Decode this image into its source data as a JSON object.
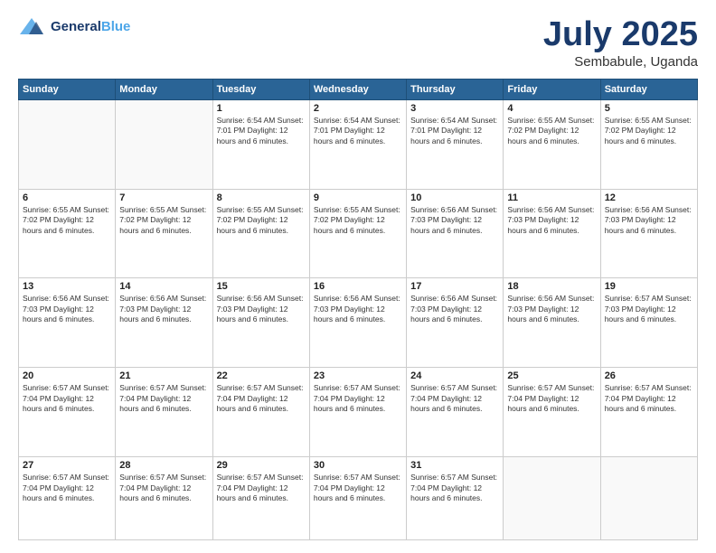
{
  "header": {
    "logo_line1": "General",
    "logo_line2": "Blue",
    "month": "July 2025",
    "location": "Sembabule, Uganda"
  },
  "days_of_week": [
    "Sunday",
    "Monday",
    "Tuesday",
    "Wednesday",
    "Thursday",
    "Friday",
    "Saturday"
  ],
  "weeks": [
    [
      {
        "day": "",
        "info": ""
      },
      {
        "day": "",
        "info": ""
      },
      {
        "day": "1",
        "info": "Sunrise: 6:54 AM\nSunset: 7:01 PM\nDaylight: 12 hours\nand 6 minutes."
      },
      {
        "day": "2",
        "info": "Sunrise: 6:54 AM\nSunset: 7:01 PM\nDaylight: 12 hours\nand 6 minutes."
      },
      {
        "day": "3",
        "info": "Sunrise: 6:54 AM\nSunset: 7:01 PM\nDaylight: 12 hours\nand 6 minutes."
      },
      {
        "day": "4",
        "info": "Sunrise: 6:55 AM\nSunset: 7:02 PM\nDaylight: 12 hours\nand 6 minutes."
      },
      {
        "day": "5",
        "info": "Sunrise: 6:55 AM\nSunset: 7:02 PM\nDaylight: 12 hours\nand 6 minutes."
      }
    ],
    [
      {
        "day": "6",
        "info": "Sunrise: 6:55 AM\nSunset: 7:02 PM\nDaylight: 12 hours\nand 6 minutes."
      },
      {
        "day": "7",
        "info": "Sunrise: 6:55 AM\nSunset: 7:02 PM\nDaylight: 12 hours\nand 6 minutes."
      },
      {
        "day": "8",
        "info": "Sunrise: 6:55 AM\nSunset: 7:02 PM\nDaylight: 12 hours\nand 6 minutes."
      },
      {
        "day": "9",
        "info": "Sunrise: 6:55 AM\nSunset: 7:02 PM\nDaylight: 12 hours\nand 6 minutes."
      },
      {
        "day": "10",
        "info": "Sunrise: 6:56 AM\nSunset: 7:03 PM\nDaylight: 12 hours\nand 6 minutes."
      },
      {
        "day": "11",
        "info": "Sunrise: 6:56 AM\nSunset: 7:03 PM\nDaylight: 12 hours\nand 6 minutes."
      },
      {
        "day": "12",
        "info": "Sunrise: 6:56 AM\nSunset: 7:03 PM\nDaylight: 12 hours\nand 6 minutes."
      }
    ],
    [
      {
        "day": "13",
        "info": "Sunrise: 6:56 AM\nSunset: 7:03 PM\nDaylight: 12 hours\nand 6 minutes."
      },
      {
        "day": "14",
        "info": "Sunrise: 6:56 AM\nSunset: 7:03 PM\nDaylight: 12 hours\nand 6 minutes."
      },
      {
        "day": "15",
        "info": "Sunrise: 6:56 AM\nSunset: 7:03 PM\nDaylight: 12 hours\nand 6 minutes."
      },
      {
        "day": "16",
        "info": "Sunrise: 6:56 AM\nSunset: 7:03 PM\nDaylight: 12 hours\nand 6 minutes."
      },
      {
        "day": "17",
        "info": "Sunrise: 6:56 AM\nSunset: 7:03 PM\nDaylight: 12 hours\nand 6 minutes."
      },
      {
        "day": "18",
        "info": "Sunrise: 6:56 AM\nSunset: 7:03 PM\nDaylight: 12 hours\nand 6 minutes."
      },
      {
        "day": "19",
        "info": "Sunrise: 6:57 AM\nSunset: 7:03 PM\nDaylight: 12 hours\nand 6 minutes."
      }
    ],
    [
      {
        "day": "20",
        "info": "Sunrise: 6:57 AM\nSunset: 7:04 PM\nDaylight: 12 hours\nand 6 minutes."
      },
      {
        "day": "21",
        "info": "Sunrise: 6:57 AM\nSunset: 7:04 PM\nDaylight: 12 hours\nand 6 minutes."
      },
      {
        "day": "22",
        "info": "Sunrise: 6:57 AM\nSunset: 7:04 PM\nDaylight: 12 hours\nand 6 minutes."
      },
      {
        "day": "23",
        "info": "Sunrise: 6:57 AM\nSunset: 7:04 PM\nDaylight: 12 hours\nand 6 minutes."
      },
      {
        "day": "24",
        "info": "Sunrise: 6:57 AM\nSunset: 7:04 PM\nDaylight: 12 hours\nand 6 minutes."
      },
      {
        "day": "25",
        "info": "Sunrise: 6:57 AM\nSunset: 7:04 PM\nDaylight: 12 hours\nand 6 minutes."
      },
      {
        "day": "26",
        "info": "Sunrise: 6:57 AM\nSunset: 7:04 PM\nDaylight: 12 hours\nand 6 minutes."
      }
    ],
    [
      {
        "day": "27",
        "info": "Sunrise: 6:57 AM\nSunset: 7:04 PM\nDaylight: 12 hours\nand 6 minutes."
      },
      {
        "day": "28",
        "info": "Sunrise: 6:57 AM\nSunset: 7:04 PM\nDaylight: 12 hours\nand 6 minutes."
      },
      {
        "day": "29",
        "info": "Sunrise: 6:57 AM\nSunset: 7:04 PM\nDaylight: 12 hours\nand 6 minutes."
      },
      {
        "day": "30",
        "info": "Sunrise: 6:57 AM\nSunset: 7:04 PM\nDaylight: 12 hours\nand 6 minutes."
      },
      {
        "day": "31",
        "info": "Sunrise: 6:57 AM\nSunset: 7:04 PM\nDaylight: 12 hours\nand 6 minutes."
      },
      {
        "day": "",
        "info": ""
      },
      {
        "day": "",
        "info": ""
      }
    ]
  ]
}
